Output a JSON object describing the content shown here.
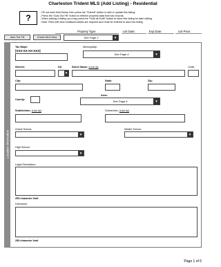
{
  "page": {
    "title": "Charleston Trident MLS (Add Listing) - Residential",
    "help_glyph": "?",
    "instructions": [
      "- Fill out each field below, then press the \"Submit\" button to add or update this listing.",
      "- Press the \"Auto Tax Fill\" button to retrieve property data from tax records.",
      "- When adding a listing, you may press the \"Hold as Draft\" button to store this listing for later editing.",
      "- Note: Field with blue boldfaced labels are required and must be entered to add new listing."
    ]
  },
  "header": {
    "property_type_label": "Property Type:",
    "list_date_label": "List Date:",
    "exp_date_label": "Exp Date:",
    "list_price_label": "List Price:",
    "auto_tax_fill_label": "Auto Tax Fill",
    "check_mls_area_label": "Check MLS Area",
    "property_type_value": "See Page 2"
  },
  "form": {
    "sidebar_label": "Location Information",
    "tax_map_label": "Tax Map#:",
    "tax_map_format": "[XXX-XX-XX-XXX]",
    "municipality_label": "Municipality:",
    "municipality_value": "See Page 4",
    "street_no_label": "Street#:",
    "dir_label": "Dir",
    "street_name_label": "Street Name:",
    "street_name_link": "(Look Up)",
    "unit_label": "Unit#:",
    "city_label": "City:",
    "state_label": "State:",
    "zip_label": "Zip:",
    "area_label": "Area:",
    "area_value": "See Page 4",
    "county_label": "County:",
    "subdivision_label": "Subdivision:",
    "subdivision_link": "(Look Up)",
    "subsection_label": "Subsection:",
    "subsection_link": "(Look Up)",
    "grade_school_label": "Grade School:",
    "middle_school_label": "Middle School:",
    "high_school_label": "High School:",
    "legal_description_label": "Legal Description:",
    "legal_limit_note": "255 character limit",
    "directions_label": "Directions:",
    "directions_limit_note": "255 character limit"
  },
  "footer": {
    "page_indicator": "Page 1 of 6"
  },
  "icons": {
    "dropdown": "chevron-down-icon"
  }
}
